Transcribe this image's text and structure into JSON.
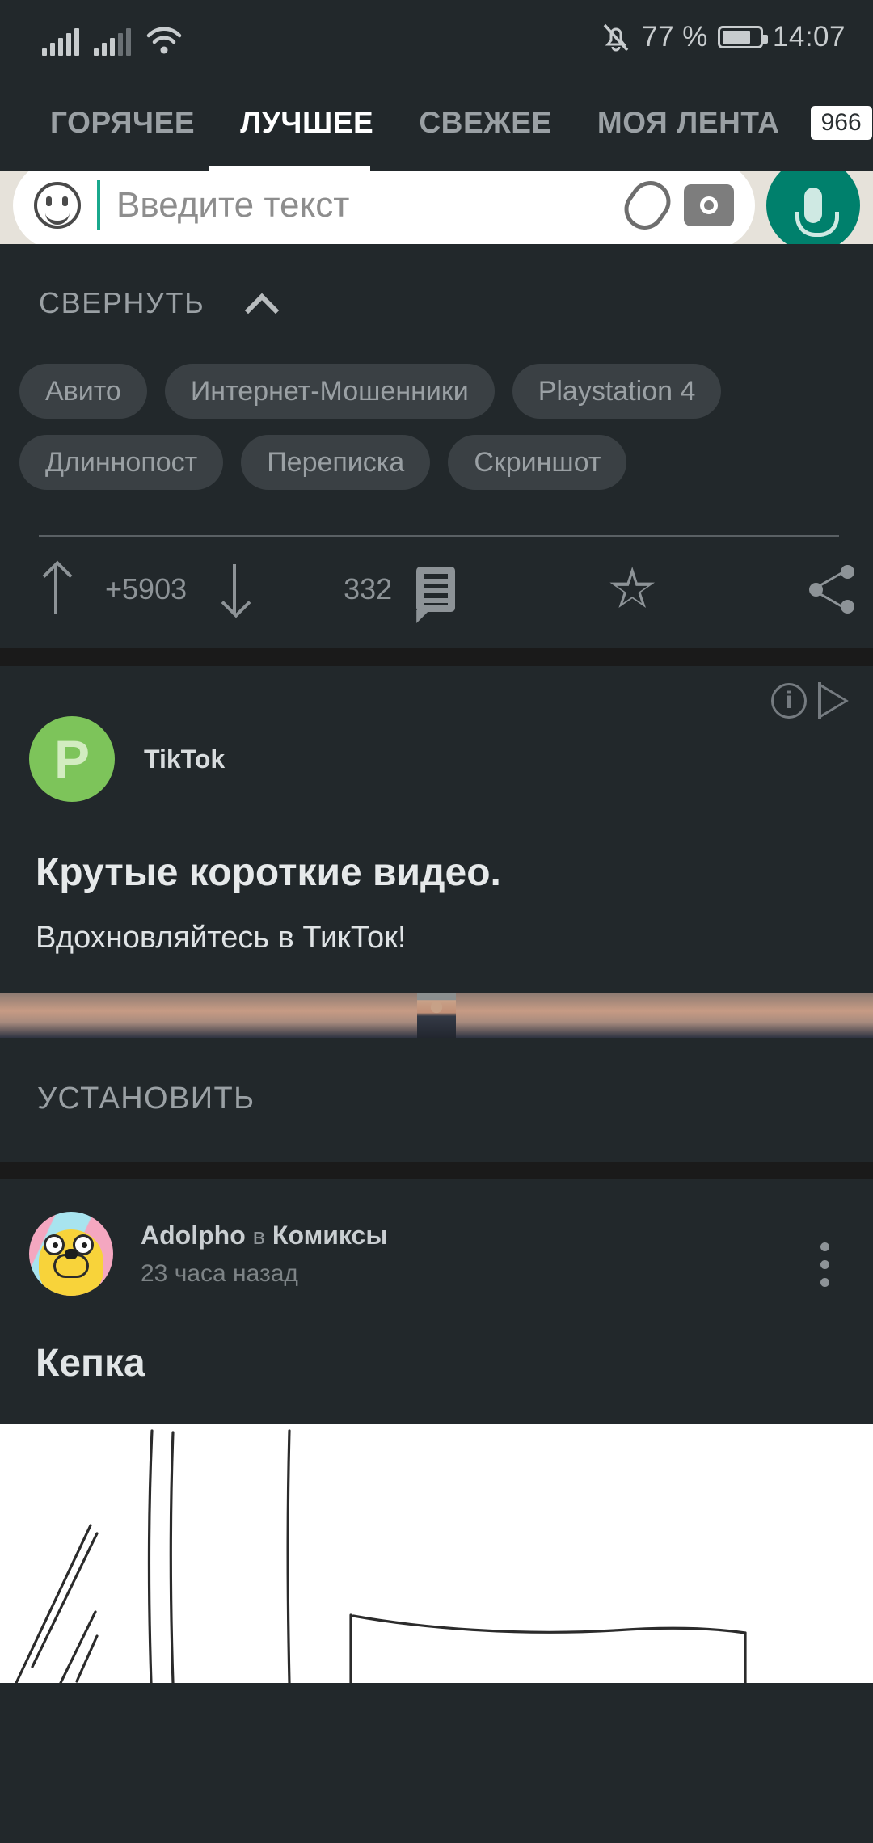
{
  "status_bar": {
    "signal_icon": "signal-bars-icon",
    "signal_icon_2": "signal-bars-secondary-icon",
    "wifi_icon": "wifi-icon",
    "mute_icon": "bell-muted-icon",
    "battery_percent": "77 %",
    "battery_icon": "battery-icon",
    "time": "14:07"
  },
  "tabs": [
    {
      "label": "ГОРЯЧЕЕ",
      "active": false
    },
    {
      "label": "ЛУЧШЕЕ",
      "active": true
    },
    {
      "label": "СВЕЖЕЕ",
      "active": false
    },
    {
      "label": "МОЯ ЛЕНТА",
      "active": false
    }
  ],
  "tab_badge": "966",
  "post_one": {
    "embedded_chat": {
      "emoji_icon": "smiley-icon",
      "placeholder": "Введите текст",
      "attach_icon": "paperclip-icon",
      "camera_icon": "camera-icon",
      "mic_icon": "microphone-icon"
    },
    "collapse_label": "СВЕРНУТЬ",
    "collapse_icon": "chevron-up-icon",
    "tags": [
      "Авито",
      "Интернет-Мошенники",
      "Playstation 4",
      "Длиннопост",
      "Переписка",
      "Скриншот"
    ],
    "actions": {
      "upvote_icon": "arrow-up-icon",
      "rating": "+5903",
      "downvote_icon": "arrow-down-icon",
      "comments_count": "332",
      "comments_icon": "comment-icon",
      "save_icon": "star-icon",
      "share_icon": "share-icon"
    }
  },
  "ad": {
    "info_icon": "info-icon",
    "info_glyph": "i",
    "adchoices_icon": "adchoices-play-icon",
    "avatar_letter": "P",
    "brand": "TikTok",
    "title": "Крутые короткие видео.",
    "subtitle": "Вдохновляйтесь в ТикТок!",
    "cta": "УСТАНОВИТЬ",
    "accent_color": "#7dc45a"
  },
  "post_two": {
    "avatar_icon": "user-avatar",
    "author": "Adolpho",
    "in_word": "в",
    "community": "Комиксы",
    "time": "23 часа назад",
    "menu_icon": "kebab-menu-icon",
    "title": "Кепка",
    "image_alt": "comic-sketch"
  },
  "theme": {
    "background": "#22282b",
    "separator": "#1a1a1a",
    "text_primary": "#e1e5e6",
    "text_secondary": "#9aa0a4",
    "chip_background": "#3a4044"
  }
}
